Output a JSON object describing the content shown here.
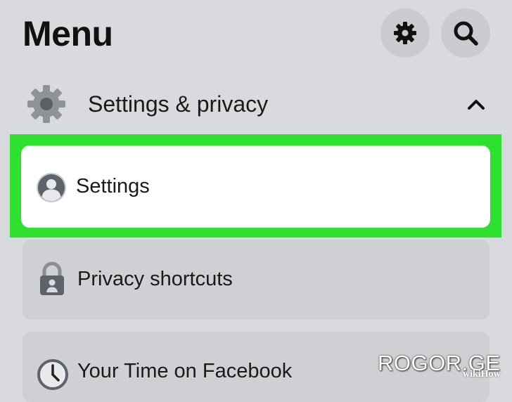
{
  "header": {
    "title": "Menu",
    "settings_button_icon": "gear-icon",
    "search_button_icon": "search-icon"
  },
  "section": {
    "label": "Settings & privacy",
    "icon": "gear-icon",
    "expanded": true,
    "chevron_icon": "chevron-up-icon"
  },
  "items": [
    {
      "label": "Settings",
      "icon": "profile-icon",
      "highlighted": true
    },
    {
      "label": "Privacy shortcuts",
      "icon": "lock-icon",
      "highlighted": false
    },
    {
      "label": "Your Time on Facebook",
      "icon": "clock-icon",
      "highlighted": false
    }
  ],
  "colors": {
    "background": "#d9dadd",
    "highlight": "#2fe12f",
    "card": "#ffffff",
    "card_inactive": "#cfd0d3"
  },
  "watermark": {
    "text": "ROGOR.GE",
    "brand": "wikiHow"
  }
}
